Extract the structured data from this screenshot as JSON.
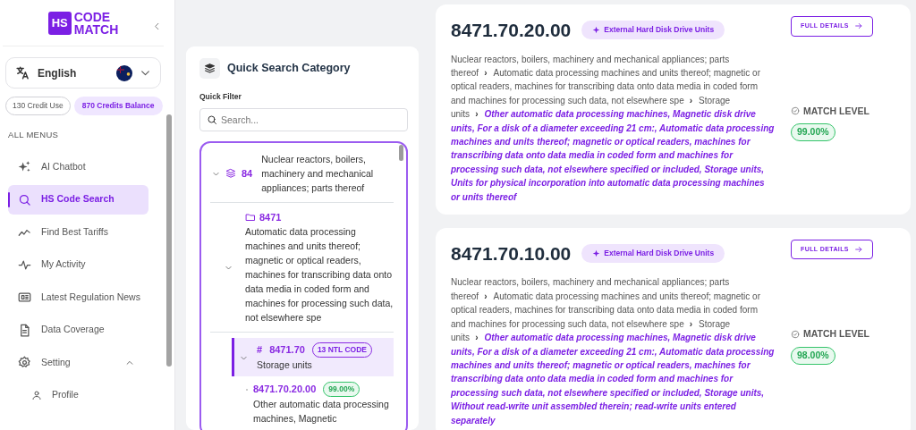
{
  "sidebar": {
    "logo": {
      "mark": "HS",
      "lines": [
        "CODE",
        "MATCH"
      ]
    },
    "language": "English",
    "credits": [
      {
        "label": "130 Credit Use",
        "kind": "outline"
      },
      {
        "label": "870 Credits Balance",
        "kind": "filled"
      }
    ],
    "menu_heading": "ALL MENUS",
    "menu": [
      {
        "label": "AI Chatbot",
        "kind": "sparkle",
        "selected": false
      },
      {
        "label": "HS Code Search",
        "kind": "search",
        "selected": true
      },
      {
        "label": "Find Best Tariffs",
        "kind": "trend",
        "selected": false
      },
      {
        "label": "My Activity",
        "kind": "pulse",
        "selected": false
      },
      {
        "label": "Latest Regulation News",
        "kind": "news",
        "selected": false
      },
      {
        "label": "Data Coverage",
        "kind": "document",
        "selected": false
      },
      {
        "label": "Setting",
        "kind": "gear",
        "selected": false,
        "expanded": true,
        "children": [
          {
            "label": "Profile",
            "kind": "user",
            "selected": false
          }
        ]
      }
    ]
  },
  "quick_search": {
    "title": "Quick Search Category",
    "filter_label": "Quick Filter",
    "search": {
      "placeholder": "Search..."
    },
    "tree": [
      {
        "kind": "chapter",
        "code": "84",
        "description": "Nuclear reactors, boilers, machinery and mechanical appliances; parts thereof",
        "expanded": true,
        "selected": false,
        "children": [
          {
            "kind": "heading",
            "code": "8471",
            "description": "Automatic data processing machines and units thereof; magnetic or optical readers, machines for transcribing data onto data media in coded form and machines for processing such data, not elsewhere spe",
            "expanded": true,
            "selected": false,
            "children": [
              {
                "kind": "subheading",
                "marker": "#",
                "code": "8471.70",
                "badge": "13 NTL CODE",
                "description": "Storage units",
                "expanded": true,
                "selected": true,
                "children": [
                  {
                    "kind": "item",
                    "code": "8471.70.20.00",
                    "match": "99.00%",
                    "description": "Other automatic data processing machines, Magnetic",
                    "selected": false
                  }
                ]
              }
            ]
          }
        ]
      }
    ]
  },
  "results": [
    {
      "code": "8471.70.20.00",
      "tag": "External Hard Disk Drive Units",
      "button": "FULL DETAILS",
      "separator": "›",
      "path": [
        "Nuclear reactors, boilers, machinery and mechanical appliances; parts thereof",
        "Automatic data processing machines and units thereof; magnetic or optical readers, machines for transcribing data onto data media in coded form and machines for processing such data, not elsewhere spe",
        "Storage units"
      ],
      "leaf": "Other automatic data processing machines, Magnetic disk drive units, For a disk of a diameter exceeding 21 cm:, Automatic data processing machines and units thereof; magnetic or optical readers, machines for transcribing data onto data media in coded form and machines for processing such data, not elsewhere specified or included, Storage units, Units for physical incorporation into automatic data processing machines or units thereof",
      "match_label": "MATCH LEVEL",
      "match": "99.00%"
    },
    {
      "code": "8471.70.10.00",
      "tag": "External Hard Disk Drive Units",
      "button": "FULL DETAILS",
      "separator": "›",
      "path": [
        "Nuclear reactors, boilers, machinery and mechanical appliances; parts thereof",
        "Automatic data processing machines and units thereof; magnetic or optical readers, machines for transcribing data onto data media in coded form and machines for processing such data, not elsewhere spe",
        "Storage units"
      ],
      "leaf": "Other automatic data processing machines, Magnetic disk drive units, For a disk of a diameter exceeding 21 cm:, Automatic data processing machines and units thereof; magnetic or optical readers, machines for transcribing data onto data media in coded form and machines for processing such data, not elsewhere specified or included, Storage units, Without read-write unit assembled therein; read-write units entered separately",
      "match_label": "MATCH LEVEL",
      "match": "98.00%"
    }
  ]
}
